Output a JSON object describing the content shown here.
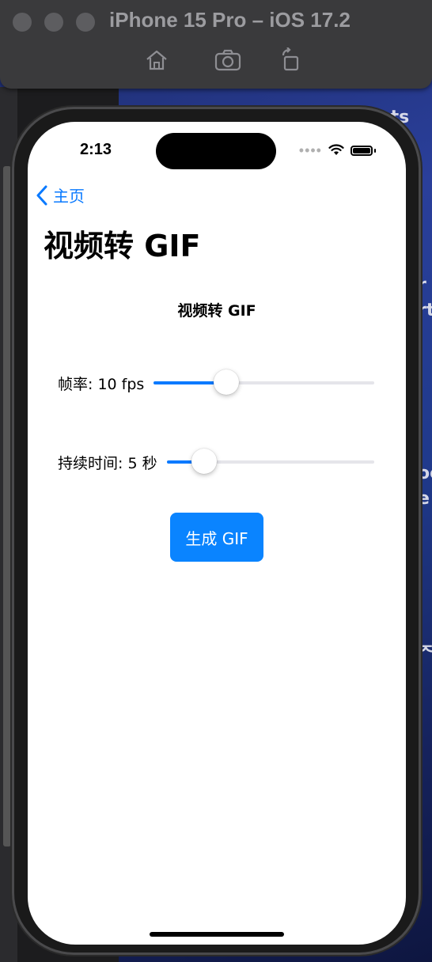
{
  "simulator": {
    "title": "iPhone 15 Pro – iOS 17.2",
    "toolbar": {
      "home_icon": "home-icon",
      "screenshot_icon": "camera-icon",
      "rotate_icon": "rotate-icon"
    }
  },
  "background_fragments": [
    "nts",
    "r",
    "rt",
    "oc",
    "e",
    "ᄌ"
  ],
  "status_bar": {
    "time": "2:13",
    "signal": "cellular-dots-icon",
    "wifi": "wifi-icon",
    "battery": "battery-icon"
  },
  "nav": {
    "back_label": "主页",
    "large_title": "视频转 GIF"
  },
  "content": {
    "section_title": "视频转 GIF",
    "frame_rate": {
      "label": "帧率: 10 fps",
      "value": 10,
      "fill_fraction": 0.33
    },
    "duration": {
      "label": "持续时间: 5 秒",
      "value": 5,
      "fill_fraction": 0.18
    },
    "generate_button": "生成 GIF"
  },
  "colors": {
    "accent": "#0a7aff",
    "button_bg": "#0a84ff",
    "track": "#e5e5ea"
  }
}
